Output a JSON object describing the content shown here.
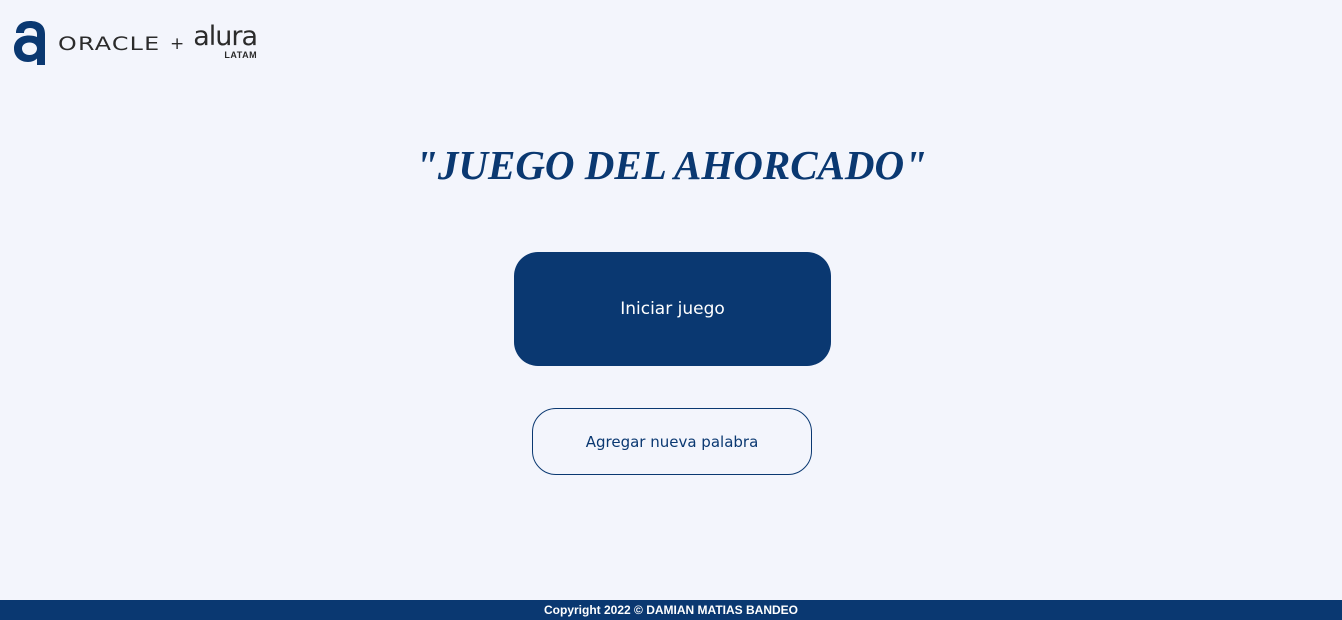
{
  "header": {
    "logo": {
      "oracle_text": "ORACLE",
      "plus": "+",
      "alura_text": "alura",
      "alura_sub": "LATAM",
      "icon": "alura-a-icon",
      "color": "#0a3871"
    }
  },
  "main": {
    "title": "\"JUEGO DEL AHORCADO\"",
    "start_button_label": "Iniciar juego",
    "add_word_button_label": "Agregar nueva palabra"
  },
  "footer": {
    "copyright": "Copyright 2022 © DAMIAN MATIAS BANDEO"
  },
  "colors": {
    "primary": "#0a3871",
    "background": "#f3f5fc",
    "button_text": "#ffffff"
  }
}
